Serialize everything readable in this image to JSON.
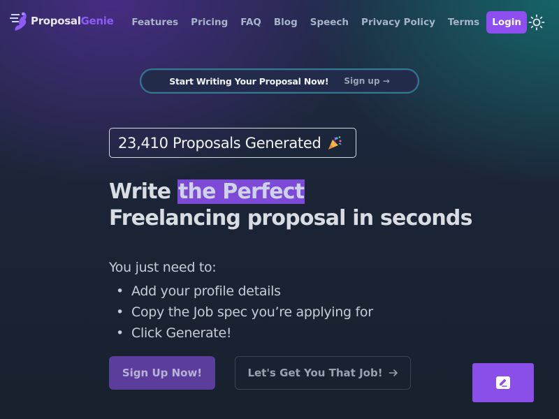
{
  "brand": {
    "name_part1": "Proposal",
    "name_part2": "Genie",
    "logo_icon": "genie-lamp-logo"
  },
  "nav": {
    "links": [
      "Features",
      "Pricing",
      "FAQ",
      "Blog",
      "Speech",
      "Privacy Policy",
      "Terms"
    ],
    "login_label": "Login",
    "theme_icon": "sun-icon"
  },
  "banner": {
    "text": "Start Writing Your Proposal Now!",
    "link_label": "Sign up →"
  },
  "counter": {
    "text": "23,410 Proposals Generated",
    "icon": "party-popper-icon"
  },
  "headline": {
    "part1": "Write ",
    "highlight": "the Perfect",
    "line2": "Freelancing proposal in seconds"
  },
  "instructions": {
    "lead": "You just need to:",
    "steps": [
      "Add your profile details",
      "Copy the Job spec you’re applying for",
      "Click Generate!"
    ]
  },
  "cta": {
    "primary": "Sign Up Now!",
    "secondary": "Let's Get You That Job!",
    "secondary_icon": "arrow-right-icon"
  },
  "feedback": {
    "icon": "pencil-edit-icon"
  },
  "colors": {
    "accent": "#8e4ff0",
    "highlight_bg": "#7c4ad6",
    "banner_border": "#2f7c8d",
    "cta_primary_bg": "#5b3e9c"
  }
}
